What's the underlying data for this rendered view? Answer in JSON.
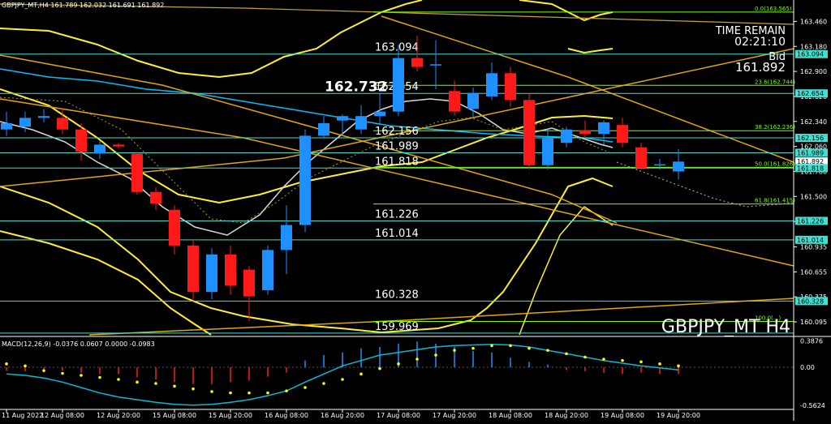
{
  "header": {
    "info": "GBPJPY_MT,H4  161.789 162.032 161.691 161.892",
    "time_remain_label": "TIME REMAIN",
    "time_remain_value": "02:21:10",
    "bid_label": "Bid",
    "bid_value": "161.892",
    "symbol_label": "GBPJPY_MT H4"
  },
  "colors": {
    "background": "#000000",
    "bull": "#1e90ff",
    "bear": "#ff1a1a",
    "bollinger": "#ffee33",
    "trendline": "#e0a800",
    "level_line": "#40e0d0",
    "fib_line": "#7fff00",
    "ma": "#d9d9d9",
    "macd_line": "#00bcd4",
    "signal_dots": "#ffff00"
  },
  "chart_data": {
    "type": "candlestick",
    "symbol": "GBPJPY_MT",
    "timeframe": "H4",
    "ylim": [
      159.95,
      163.7
    ],
    "candles": [
      {
        "o": 162.25,
        "h": 162.45,
        "l": 162.18,
        "c": 162.32
      },
      {
        "o": 162.28,
        "h": 162.45,
        "l": 162.22,
        "c": 162.38
      },
      {
        "o": 162.38,
        "h": 162.48,
        "l": 162.33,
        "c": 162.4
      },
      {
        "o": 162.38,
        "h": 162.48,
        "l": 162.2,
        "c": 162.25
      },
      {
        "o": 162.25,
        "h": 162.32,
        "l": 161.9,
        "c": 162.0
      },
      {
        "o": 161.98,
        "h": 162.12,
        "l": 161.92,
        "c": 162.08
      },
      {
        "o": 162.08,
        "h": 162.1,
        "l": 162.04,
        "c": 162.06
      },
      {
        "o": 161.98,
        "h": 162.0,
        "l": 161.52,
        "c": 161.55
      },
      {
        "o": 161.55,
        "h": 161.6,
        "l": 161.35,
        "c": 161.42
      },
      {
        "o": 161.35,
        "h": 161.4,
        "l": 160.85,
        "c": 160.95
      },
      {
        "o": 160.95,
        "h": 161.02,
        "l": 160.35,
        "c": 160.43
      },
      {
        "o": 160.43,
        "h": 160.92,
        "l": 160.35,
        "c": 160.85
      },
      {
        "o": 160.85,
        "h": 160.95,
        "l": 160.4,
        "c": 160.5
      },
      {
        "o": 160.68,
        "h": 160.72,
        "l": 160.1,
        "c": 160.38
      },
      {
        "o": 160.45,
        "h": 160.95,
        "l": 160.4,
        "c": 160.9
      },
      {
        "o": 160.9,
        "h": 161.4,
        "l": 160.63,
        "c": 161.18
      },
      {
        "o": 161.18,
        "h": 162.25,
        "l": 161.1,
        "c": 162.18
      },
      {
        "o": 162.18,
        "h": 162.4,
        "l": 162.15,
        "c": 162.32
      },
      {
        "o": 162.35,
        "h": 162.42,
        "l": 162.18,
        "c": 162.4
      },
      {
        "o": 162.25,
        "h": 162.52,
        "l": 162.2,
        "c": 162.4
      },
      {
        "o": 162.4,
        "h": 162.65,
        "l": 162.3,
        "c": 162.45
      },
      {
        "o": 162.45,
        "h": 163.2,
        "l": 162.4,
        "c": 163.05
      },
      {
        "o": 163.05,
        "h": 163.3,
        "l": 162.9,
        "c": 162.95
      },
      {
        "o": 162.98,
        "h": 163.25,
        "l": 162.7,
        "c": 162.98
      },
      {
        "o": 162.68,
        "h": 162.8,
        "l": 162.4,
        "c": 162.45
      },
      {
        "o": 162.48,
        "h": 162.72,
        "l": 162.38,
        "c": 162.66
      },
      {
        "o": 162.62,
        "h": 163.0,
        "l": 162.58,
        "c": 162.88
      },
      {
        "o": 162.88,
        "h": 162.95,
        "l": 162.5,
        "c": 162.58
      },
      {
        "o": 162.58,
        "h": 162.65,
        "l": 161.8,
        "c": 161.85
      },
      {
        "o": 161.85,
        "h": 162.25,
        "l": 161.8,
        "c": 162.15
      },
      {
        "o": 162.1,
        "h": 162.28,
        "l": 162.05,
        "c": 162.25
      },
      {
        "o": 162.24,
        "h": 162.35,
        "l": 162.15,
        "c": 162.2
      },
      {
        "o": 162.2,
        "h": 162.35,
        "l": 162.08,
        "c": 162.33
      },
      {
        "o": 162.3,
        "h": 162.38,
        "l": 162.05,
        "c": 162.1
      },
      {
        "o": 162.05,
        "h": 162.1,
        "l": 161.8,
        "c": 161.82
      },
      {
        "o": 161.85,
        "h": 161.92,
        "l": 161.8,
        "c": 161.86
      },
      {
        "o": 161.78,
        "h": 162.03,
        "l": 161.69,
        "c": 161.89
      }
    ],
    "price_levels": [
      {
        "label": "163.094",
        "value": 163.094
      },
      {
        "label": "162.654",
        "value": 162.654
      },
      {
        "label": "162.156",
        "value": 162.156
      },
      {
        "label": "161.989",
        "value": 161.989
      },
      {
        "label": "161.818",
        "value": 161.818
      },
      {
        "label": "161.226",
        "value": 161.226
      },
      {
        "label": "161.014",
        "value": 161.014
      },
      {
        "label": "160.328",
        "value": 160.328
      },
      {
        "label": "159.969",
        "value": 159.969
      }
    ],
    "high_marker": {
      "label": "162.732",
      "value": 162.732
    },
    "fib_levels": [
      {
        "label": "0.0(163.565)",
        "value": 163.565
      },
      {
        "label": "23.6(162.744)",
        "value": 162.744
      },
      {
        "label": "38.2(162.236)",
        "value": 162.236
      },
      {
        "label": "50.0(161.826)",
        "value": 161.826
      },
      {
        "label": "61.8(161.415)",
        "value": 161.415
      },
      {
        "label": "100.0(...)",
        "value": 160.1
      }
    ],
    "y_axis_ticks": [
      "163.460",
      "163.180",
      "162.900",
      "162.620",
      "162.340",
      "162.060",
      "161.780",
      "161.500",
      "161.220",
      "160.935",
      "160.655",
      "160.375",
      "160.095"
    ],
    "y_axis_tick_values": [
      163.46,
      163.18,
      162.9,
      162.62,
      162.34,
      162.06,
      161.78,
      161.5,
      161.22,
      160.935,
      160.655,
      160.375,
      160.095
    ],
    "right_tags": [
      {
        "label": "163.094",
        "value": 163.094,
        "color": "#40e0d0"
      },
      {
        "label": "162.654",
        "value": 162.654,
        "color": "#40e0d0"
      },
      {
        "label": "162.156",
        "value": 162.156,
        "color": "#40e0d0"
      },
      {
        "label": "161.989",
        "value": 161.989,
        "color": "#40e0d0"
      },
      {
        "label": "161.892",
        "value": 161.892,
        "color": "#ffffff"
      },
      {
        "label": "161.818",
        "value": 161.818,
        "color": "#40e0d0"
      },
      {
        "label": "161.226",
        "value": 161.226,
        "color": "#40e0d0"
      },
      {
        "label": "161.014",
        "value": 161.014,
        "color": "#40e0d0"
      },
      {
        "label": "160.328",
        "value": 160.328,
        "color": "#40e0d0"
      }
    ],
    "x_axis_ticks": [
      {
        "label": "11 Aug 2022",
        "index": 0
      },
      {
        "label": "12 Aug 08:00",
        "index": 3
      },
      {
        "label": "12 Aug 20:00",
        "index": 6
      },
      {
        "label": "15 Aug 08:00",
        "index": 9
      },
      {
        "label": "15 Aug 20:00",
        "index": 12
      },
      {
        "label": "16 Aug 08:00",
        "index": 15
      },
      {
        "label": "16 Aug 20:00",
        "index": 18
      },
      {
        "label": "17 Aug 08:00",
        "index": 21
      },
      {
        "label": "17 Aug 20:00",
        "index": 24
      },
      {
        "label": "18 Aug 08:00",
        "index": 27
      },
      {
        "label": "18 Aug 20:00",
        "index": 30
      },
      {
        "label": "19 Aug 08:00",
        "index": 33
      },
      {
        "label": "19 Aug 20:00",
        "index": 36
      }
    ],
    "macd": {
      "label": "MACD(12,26,9) -0.0376 0.0607 0.0000 -0.0983",
      "ylim": [
        -0.6,
        0.42
      ],
      "ticks": [
        "0.3876",
        "0.00",
        "-0.5624"
      ],
      "tick_values": [
        0.3876,
        0.0,
        -0.5624
      ],
      "histogram": [
        -0.05,
        -0.06,
        -0.05,
        -0.05,
        -0.08,
        -0.1,
        -0.1,
        -0.15,
        -0.18,
        -0.22,
        -0.25,
        -0.25,
        -0.22,
        -0.2,
        -0.14,
        -0.08,
        0.1,
        0.18,
        0.22,
        0.28,
        0.3,
        0.35,
        0.38,
        0.35,
        0.3,
        0.24,
        0.22,
        0.14,
        0.08,
        0.04,
        -0.04,
        -0.06,
        -0.08,
        -0.1,
        -0.08,
        -0.1,
        -0.1
      ],
      "macd_line": [
        -0.1,
        -0.12,
        -0.16,
        -0.22,
        -0.3,
        -0.38,
        -0.44,
        -0.48,
        -0.52,
        -0.55,
        -0.56,
        -0.55,
        -0.52,
        -0.48,
        -0.42,
        -0.35,
        -0.22,
        -0.1,
        0.02,
        0.1,
        0.18,
        0.22,
        0.26,
        0.3,
        0.32,
        0.33,
        0.34,
        0.33,
        0.3,
        0.25,
        0.2,
        0.15,
        0.1,
        0.06,
        0.02,
        -0.01,
        -0.04
      ],
      "signal_dots": [
        0.05,
        0.02,
        -0.05,
        -0.09,
        -0.12,
        -0.15,
        -0.18,
        -0.22,
        -0.24,
        -0.28,
        -0.32,
        -0.36,
        -0.38,
        -0.38,
        -0.38,
        -0.35,
        -0.3,
        -0.24,
        -0.18,
        -0.1,
        -0.02,
        0.05,
        0.12,
        0.18,
        0.25,
        0.28,
        0.32,
        0.32,
        0.28,
        0.25,
        0.2,
        0.15,
        0.12,
        0.1,
        0.08,
        0.05,
        0.02
      ]
    }
  }
}
